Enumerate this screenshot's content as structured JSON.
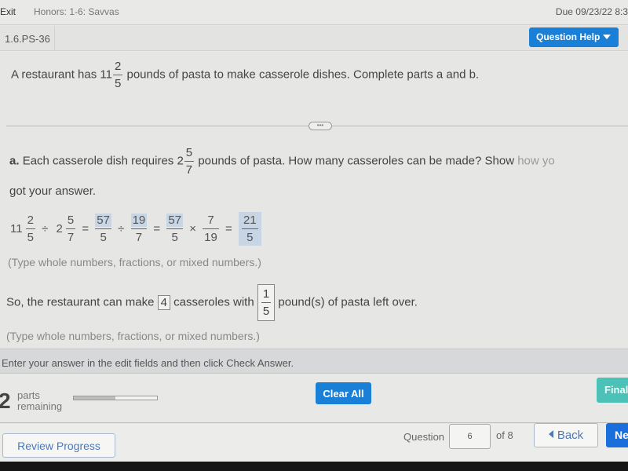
{
  "topbar": {
    "exit_label": "Exit",
    "course_title": "Honors: 1-6: Savvas",
    "due_text": "Due 09/23/22 8:3"
  },
  "question_bar": {
    "question_id": "1.6.PS-36",
    "help_label": "Question Help",
    "more_glyph": "⋮"
  },
  "stem": {
    "prefix": "A restaurant has 11",
    "frac_num": "2",
    "frac_den": "5",
    "suffix": "pounds of pasta to make casserole dishes. Complete parts a and b."
  },
  "divider_handle": "•••",
  "part_a": {
    "label": "a.",
    "prefix": "Each casserole dish requires 2",
    "frac_num": "5",
    "frac_den": "7",
    "suffix": "pounds of pasta. How many casseroles can be made? Show",
    "faded": "how yo",
    "line2": "got your answer.",
    "equation": {
      "t1_whole": "11",
      "t1_num": "2",
      "t1_den": "5",
      "div": "÷",
      "t2_whole": "2",
      "t2_num": "5",
      "t2_den": "7",
      "eq": "=",
      "a1_num": "57",
      "a1_den": "5",
      "a2_num": "19",
      "a2_den": "7",
      "a3_num": "57",
      "a3_den": "5",
      "times": "×",
      "m_num": "7",
      "m_den": "19",
      "res_num": "21",
      "res_den": "5"
    },
    "hint": "(Type whole numbers, fractions, or mixed numbers.)"
  },
  "part_b": {
    "prefix": "So, the restaurant can make",
    "count_value": "4",
    "middle": "casseroles with",
    "left_num": "1",
    "left_den": "5",
    "suffix": "pound(s) of pasta left over.",
    "hint": "(Type whole numbers, fractions, or mixed numbers.)"
  },
  "instruction": "Enter your answer in the edit fields and then click Check Answer.",
  "actions": {
    "parts_count": "2",
    "parts_label_1": "parts",
    "parts_label_2": "remaining",
    "progress_fraction": 0.5,
    "clear_label": "Clear All",
    "final_label": "Final"
  },
  "footer": {
    "review_label": "Review Progress",
    "question_label": "Question",
    "question_value": "6",
    "of_label": "of 8",
    "back_label": "Back",
    "next_label": "Ne"
  },
  "colors": {
    "primary": "#1a7fd6",
    "final": "#4cc1b8",
    "answer_highlight": "#c8d5e4",
    "link": "#4d79b8"
  }
}
